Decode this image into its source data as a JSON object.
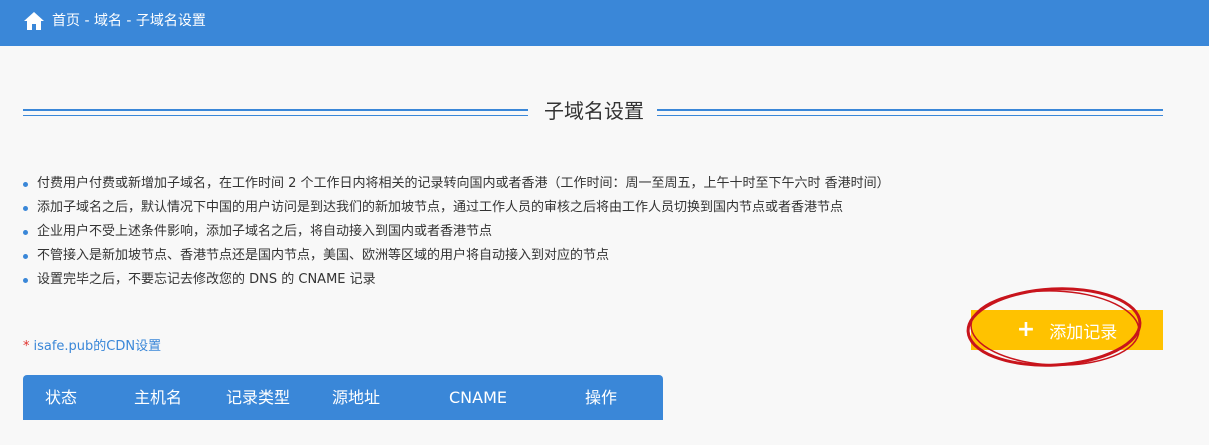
{
  "header": {
    "breadcrumb": "首页 - 域名 - 子域名设置",
    "home_icon": "home-icon",
    "bg_color": "#3a87d8"
  },
  "section": {
    "title": "子域名设置"
  },
  "notes": [
    "付费用户付费或新增加子域名，在工作时间 2 个工作日内将相关的记录转向国内或者香港（工作时间：周一至周五，上午十时至下午六时 香港时间）",
    "添加子域名之后，默认情况下中国的用户访问是到达我们的新加坡节点，通过工作人员的审核之后将由工作人员切换到国内节点或者香港节点",
    "企业用户不受上述条件影响，添加子域名之后，将自动接入到国内或者香港节点",
    "不管接入是新加坡节点、香港节点还是国内节点，美国、欧洲等区域的用户将自动接入到对应的节点",
    "设置完毕之后，不要忘记去修改您的 DNS 的 CNAME 记录"
  ],
  "add_button": {
    "label": "添加记录",
    "icon": "plus-icon",
    "color": "#ffc200"
  },
  "cdn_note": {
    "star": "*",
    "text": "isafe.pub的CDN设置"
  },
  "table": {
    "columns": [
      "状态",
      "主机名",
      "记录类型",
      "源地址",
      "CNAME",
      "操作"
    ]
  },
  "annotation": {
    "color": "#c8141c"
  }
}
